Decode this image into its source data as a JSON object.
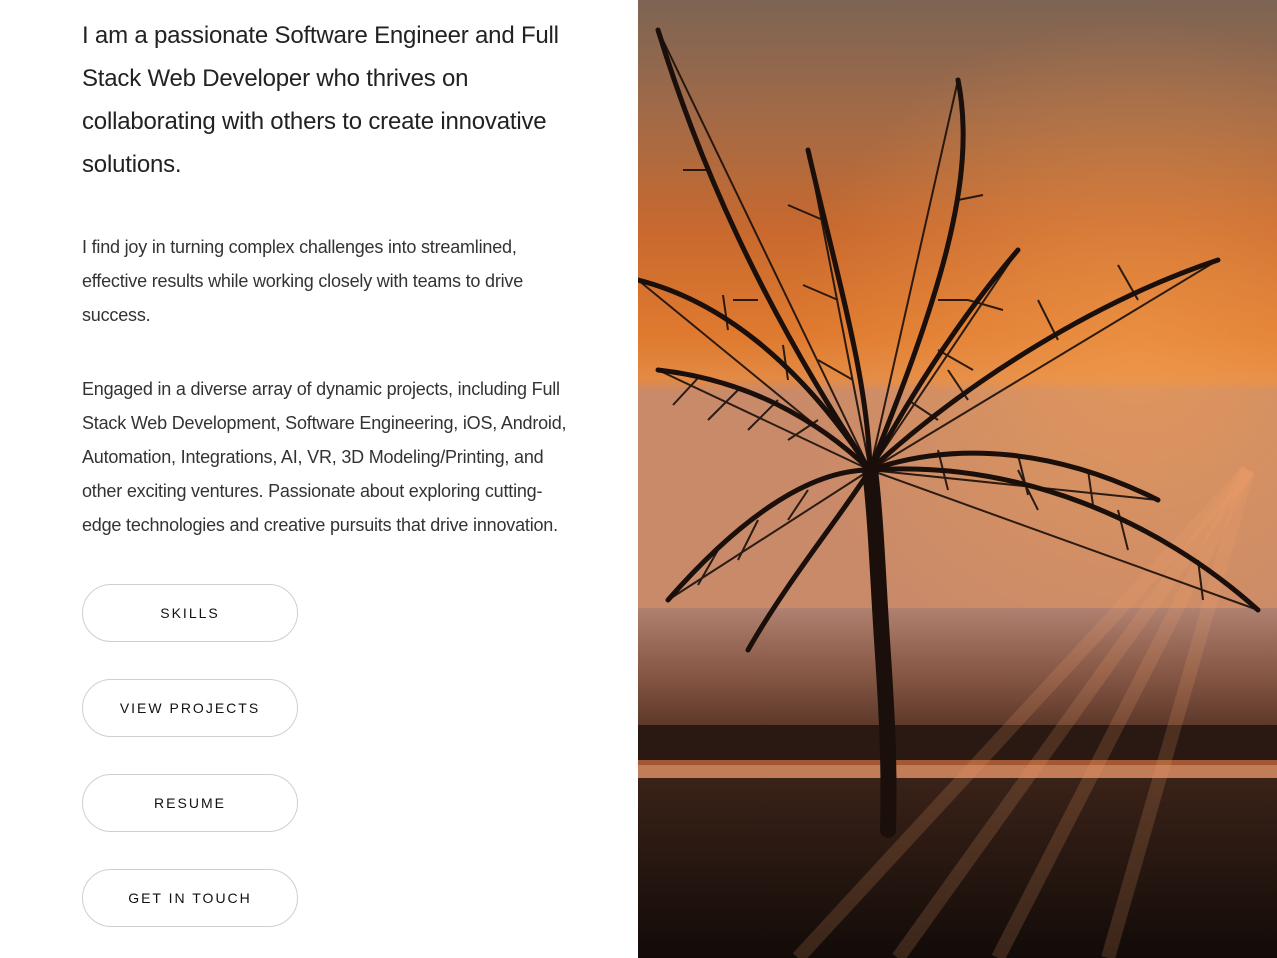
{
  "about": {
    "lead": "I am a passionate Software Engineer and Full Stack Web Developer who thrives on collaborating with others to create innovative solutions.",
    "paragraph_1": "I find joy in turning complex challenges into streamlined, effective results while working closely with teams to drive success.",
    "paragraph_2": "Engaged in a diverse array of dynamic projects, including Full Stack Web Development, Software Engineering, iOS, Android, Automation, Integrations, AI, VR, 3D Modeling/Printing, and other exciting ventures. Passionate about exploring cutting-edge technologies and creative pursuits that drive innovation."
  },
  "buttons": {
    "skills": "SKILLS",
    "view_projects": "VIEW PROJECTS",
    "resume": "RESUME",
    "get_in_touch": "GET IN TOUCH"
  },
  "hero_image": {
    "subject": "palm-tree-sunset-beach",
    "colors": {
      "sky_top": "#8a6a52",
      "sky_mid": "#d9742c",
      "sky_low": "#e8873a",
      "sea": "#6e4a38",
      "sand": "#1e140f"
    }
  }
}
